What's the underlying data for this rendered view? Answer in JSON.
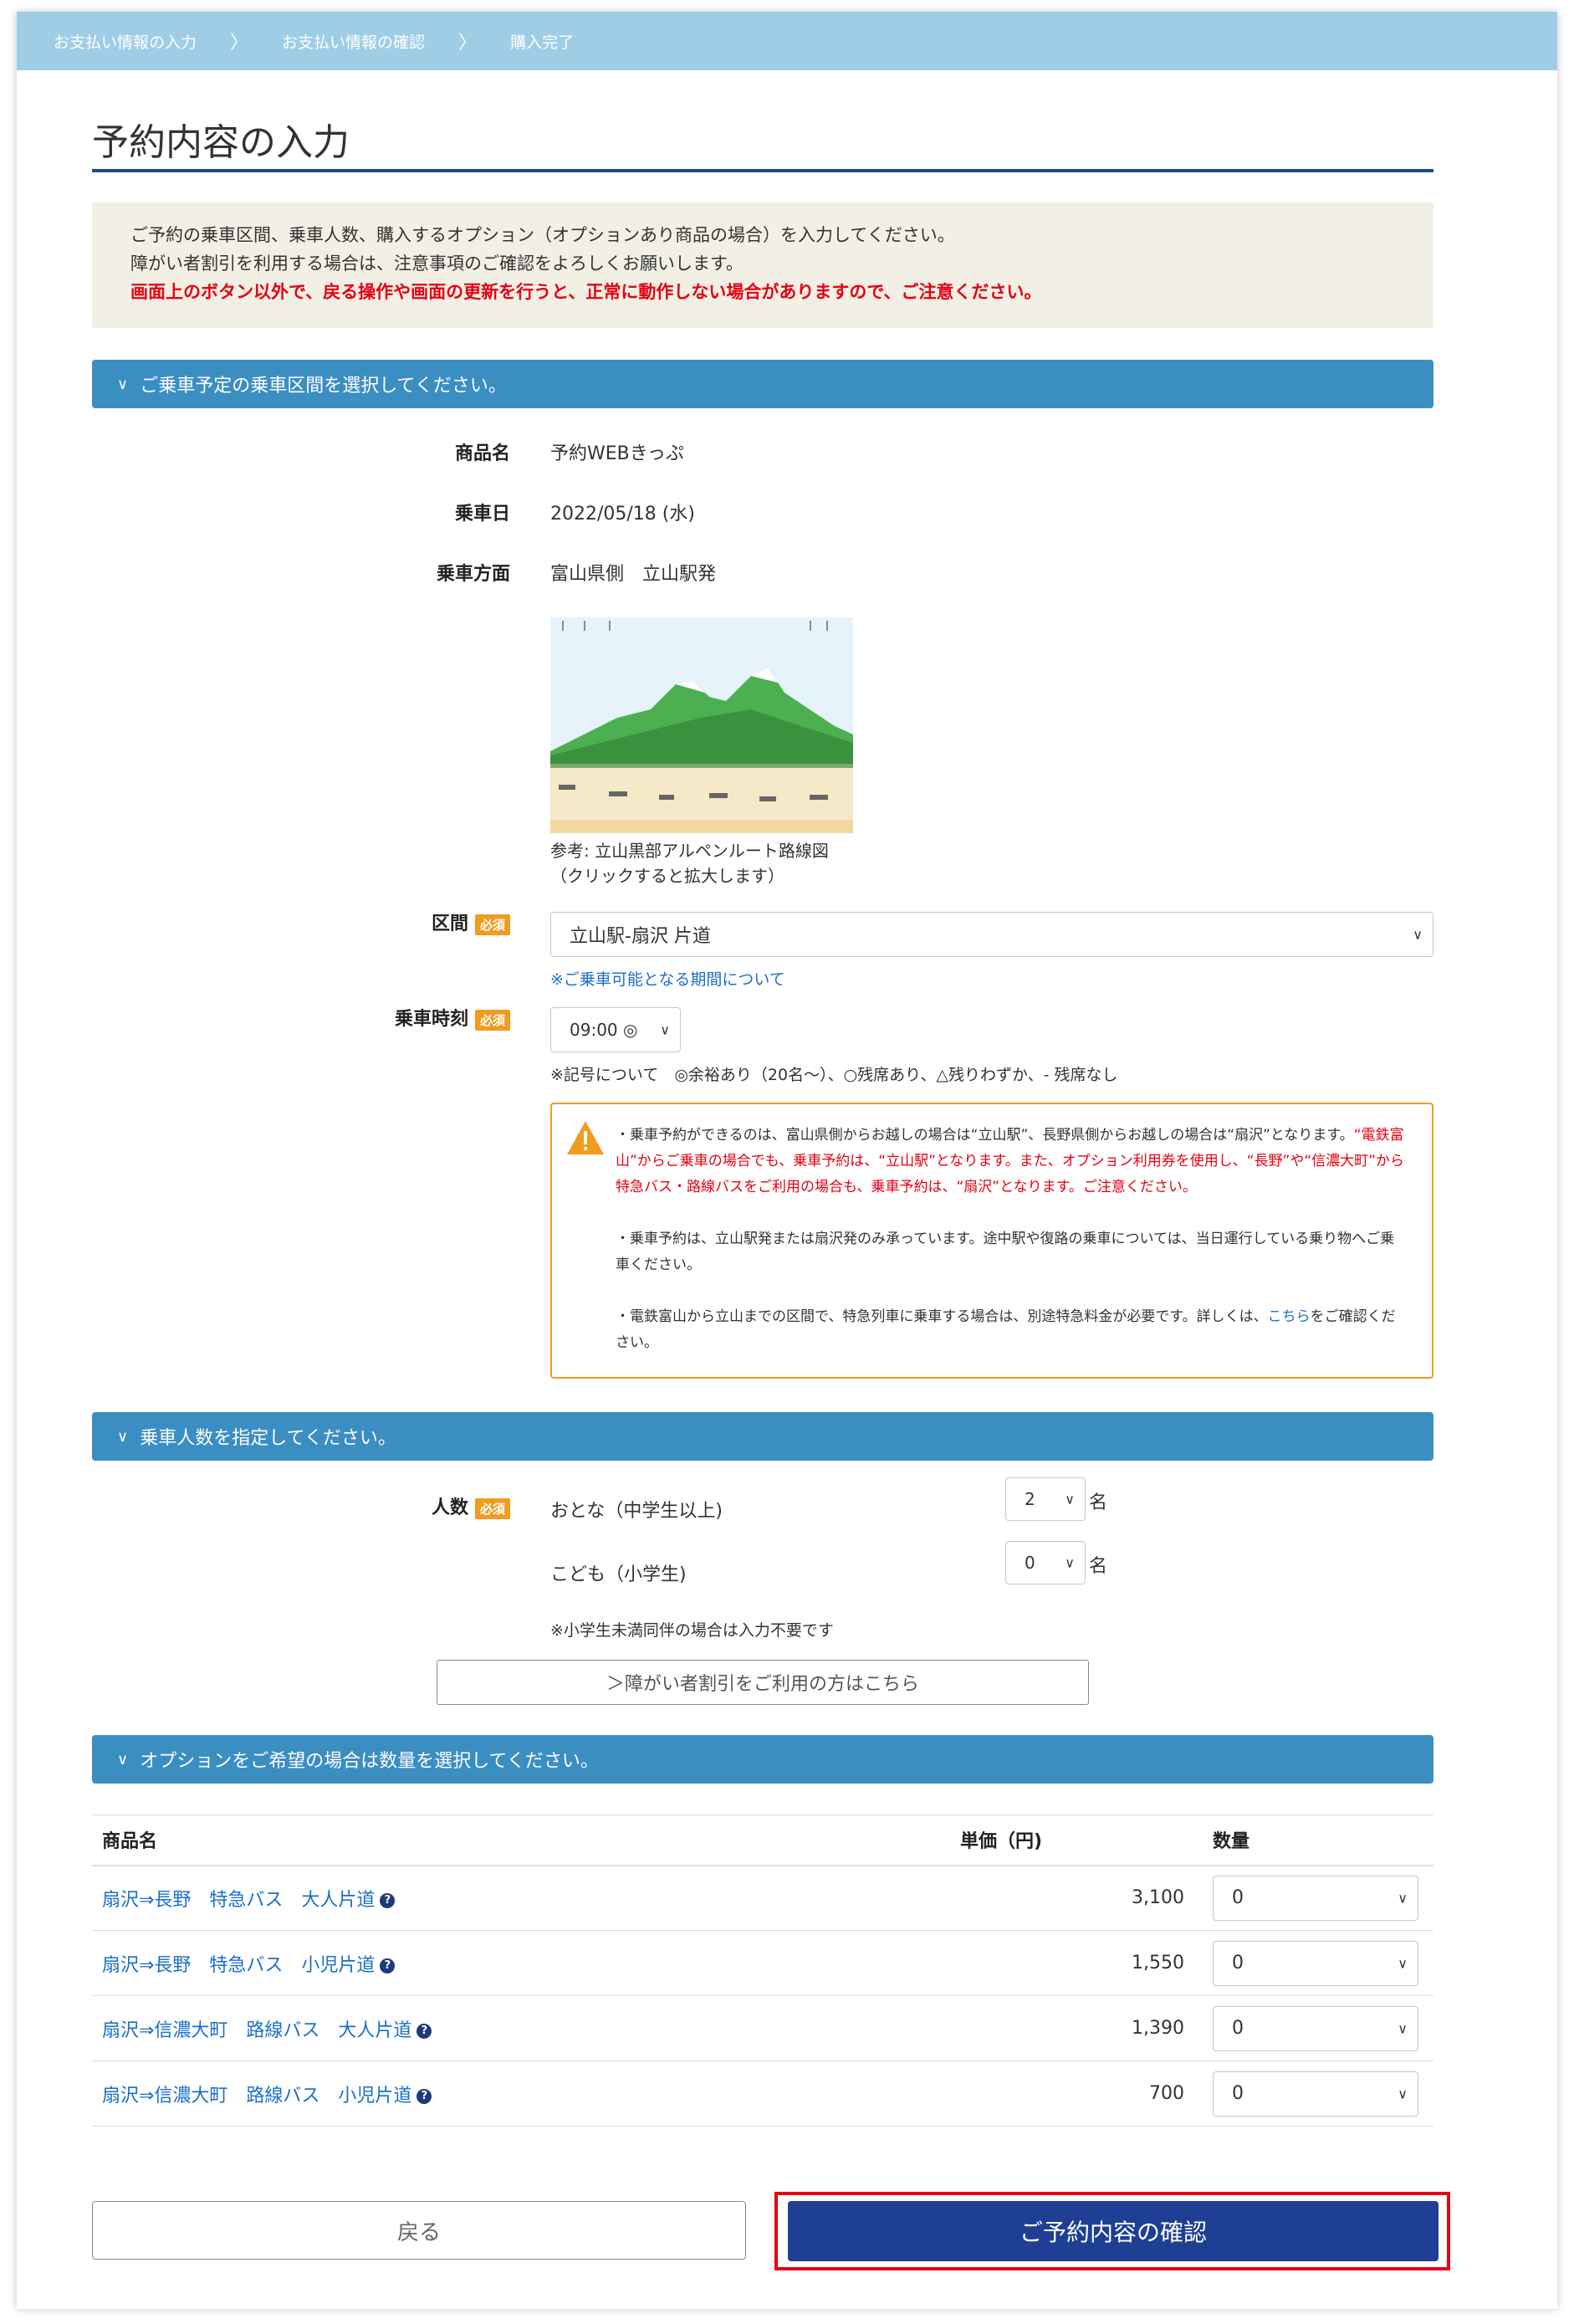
{
  "breadcrumb": [
    "お支払い情報の入力",
    "お支払い情報の確認",
    "購入完了"
  ],
  "breadcrumb_sep": "〉",
  "title": "予約内容の入力",
  "notice": {
    "line1": "ご予約の乗車区間、乗車人数、購入するオプション（オプションあり商品の場合）を入力してください。",
    "line2": "障がい者割引を利用する場合は、注意事項のご確認をよろしくお願いします。",
    "line3": "画面上のボタン以外で、戻る操作や画面の更新を行うと、正常に動作しない場合がありますので、ご注意ください。"
  },
  "section1": {
    "heading": "ご乗車予定の乗車区間を選択してください。",
    "product_label": "商品名",
    "product_value": "予約WEBきっぷ",
    "date_label": "乗車日",
    "date_value": "2022/05/18 (水)",
    "direction_label": "乗車方面",
    "direction_value": "富山県側　立山駅発",
    "map_caption_1": "参考: 立山黒部アルペンルート路線図",
    "map_caption_2": "（クリックすると拡大します）",
    "route_label": "区間",
    "required": "必須",
    "route_value": "立山駅-扇沢 片道",
    "route_note": "※ご乗車可能となる期間について",
    "time_label": "乗車時刻",
    "time_value": "09:00 ◎",
    "time_note": "※記号について　◎余裕あり（20名〜）、○残席あり、△残りわずか、- 残席なし",
    "warning": {
      "p1_a": "・乗車予約ができるのは、富山県側からお越しの場合は“立山駅”、長野県側からお越しの場合は“扇沢”となります。",
      "p1_b": "“電鉄富山”からご乗車の場合でも、乗車予約は、“立山駅”となります。また、オプション利用券を使用し、“長野”や“信濃大町”から特急バス・路線バスをご利用の場合も、乗車予約は、“扇沢”となります。ご注意ください。",
      "p2": "・乗車予約は、立山駅発または扇沢発のみ承っています。途中駅や復路の乗車については、当日運行している乗り物へご乗車ください。",
      "p3_a": "・電鉄富山から立山までの区間で、特急列車に乗車する場合は、別途特急料金が必要です。詳しくは、",
      "p3_link": "こちら",
      "p3_b": "をご確認ください。"
    }
  },
  "section2": {
    "heading": "乗車人数を指定してください。",
    "people_label": "人数",
    "required": "必須",
    "adult_label": "おとな（中学生以上)",
    "adult_value": "2",
    "child_label": "こども（小学生)",
    "child_value": "0",
    "unit": "名",
    "note": "※小学生未満同伴の場合は入力不要です",
    "discount_button": "＞障がい者割引をご利用の方はこちら"
  },
  "section3": {
    "heading": "オプションをご希望の場合は数量を選択してください。",
    "col_name": "商品名",
    "col_price": "単価（円)",
    "col_qty": "数量",
    "rows": [
      {
        "name": "扇沢⇒長野　特急バス　大人片道",
        "price": "3,100",
        "qty": "0"
      },
      {
        "name": "扇沢⇒長野　特急バス　小児片道",
        "price": "1,550",
        "qty": "0"
      },
      {
        "name": "扇沢⇒信濃大町　路線バス　大人片道",
        "price": "1,390",
        "qty": "0"
      },
      {
        "name": "扇沢⇒信濃大町　路線バス　小児片道",
        "price": "700",
        "qty": "0"
      }
    ]
  },
  "buttons": {
    "back": "戻る",
    "confirm": "ご予約内容の確認"
  },
  "colors": {
    "header_bar": "#9fcde6",
    "section_head": "#3b8ec2",
    "confirm_button": "#1e3f93",
    "required_badge": "#f29b1f",
    "alert_red": "#e60012"
  }
}
